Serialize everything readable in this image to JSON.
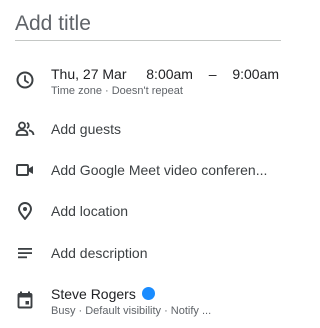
{
  "title": {
    "placeholder": "Add title"
  },
  "datetime": {
    "date": "Thu, 27 Mar",
    "start": "8:00am",
    "separator": "–",
    "end": "9:00am",
    "details": "Time zone · Doesn't repeat"
  },
  "rows": {
    "guests": "Add guests",
    "meet": "Add Google Meet video conferen...",
    "location": "Add location",
    "description": "Add description"
  },
  "calendar": {
    "owner": "Steve Rogers",
    "color": "#1a8cff",
    "details": "Busy · Default visibility · Notify ..."
  },
  "icons": [
    "clock-icon",
    "people-icon",
    "video-icon",
    "location-pin-icon",
    "description-lines-icon",
    "calendar-icon"
  ]
}
